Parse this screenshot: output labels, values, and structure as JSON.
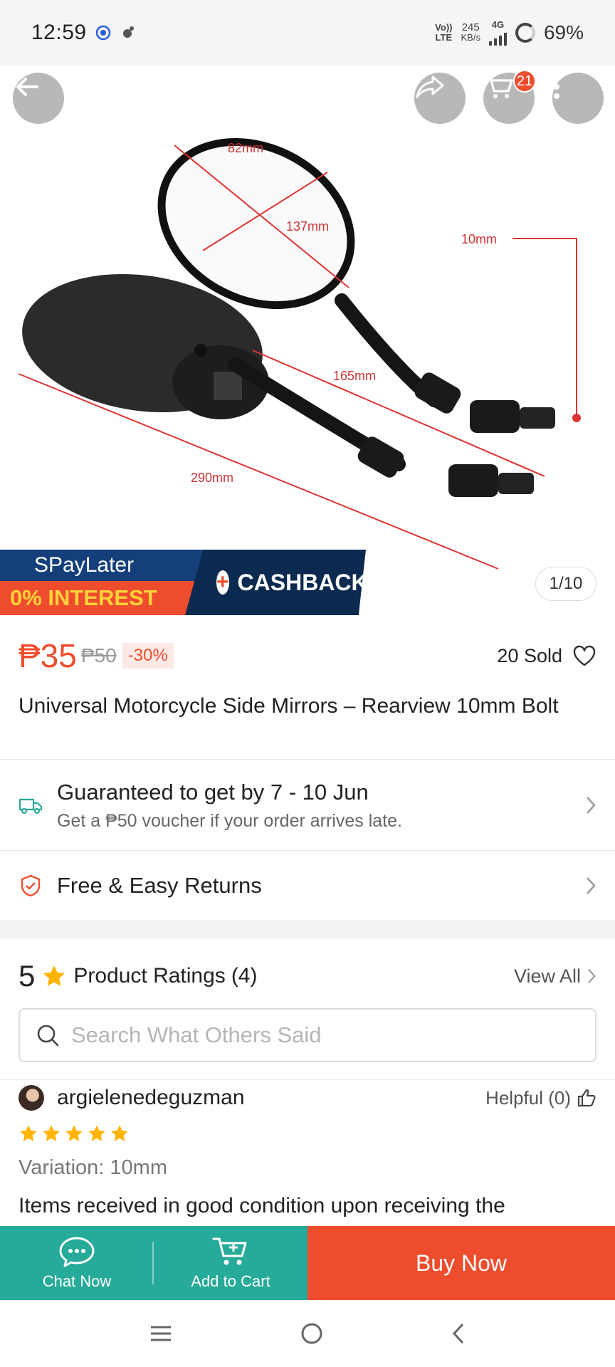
{
  "status_bar": {
    "time": "12:59",
    "network_top": "Vo))",
    "network_bottom": "LTE",
    "speed_value": "245",
    "speed_unit": "KB/s",
    "net_type": "4G",
    "battery": "69%"
  },
  "gallery": {
    "counter": "1/10",
    "cart_count": "21",
    "promo": {
      "spaylater": "SPayLater",
      "interest": "0% INTEREST",
      "cashback": "CASHBACK"
    },
    "image_labels": {
      "width": "82mm",
      "height": "137mm",
      "bolt": "10mm",
      "arm": "165mm",
      "total": "290mm"
    }
  },
  "product": {
    "price": "₱35",
    "original_price": "₱50",
    "discount": "-30%",
    "sold": "20 Sold",
    "title": "Universal Motorcycle Side Mirrors – Rearview 10mm Bolt"
  },
  "shipping": {
    "title": "Guaranteed to get by 7 - 10 Jun",
    "subtitle": "Get a ₱50 voucher if your order arrives late."
  },
  "returns": {
    "title": "Free & Easy Returns"
  },
  "ratings": {
    "score": "5",
    "title": "Product Ratings",
    "count": "(4)",
    "view_all": "View All",
    "search_placeholder": "Search What Others Said"
  },
  "review": {
    "user": "argielenedeguzman",
    "helpful": "Helpful (0)",
    "stars": 5,
    "variation": "Variation: 10mm",
    "text": "Items received in good condition upon receiving the"
  },
  "bottom_bar": {
    "chat": "Chat Now",
    "add_to_cart": "Add to Cart",
    "buy_now": "Buy Now"
  },
  "colors": {
    "accent": "#ee4d2d",
    "teal": "#26aa99",
    "star": "#ffb400"
  }
}
